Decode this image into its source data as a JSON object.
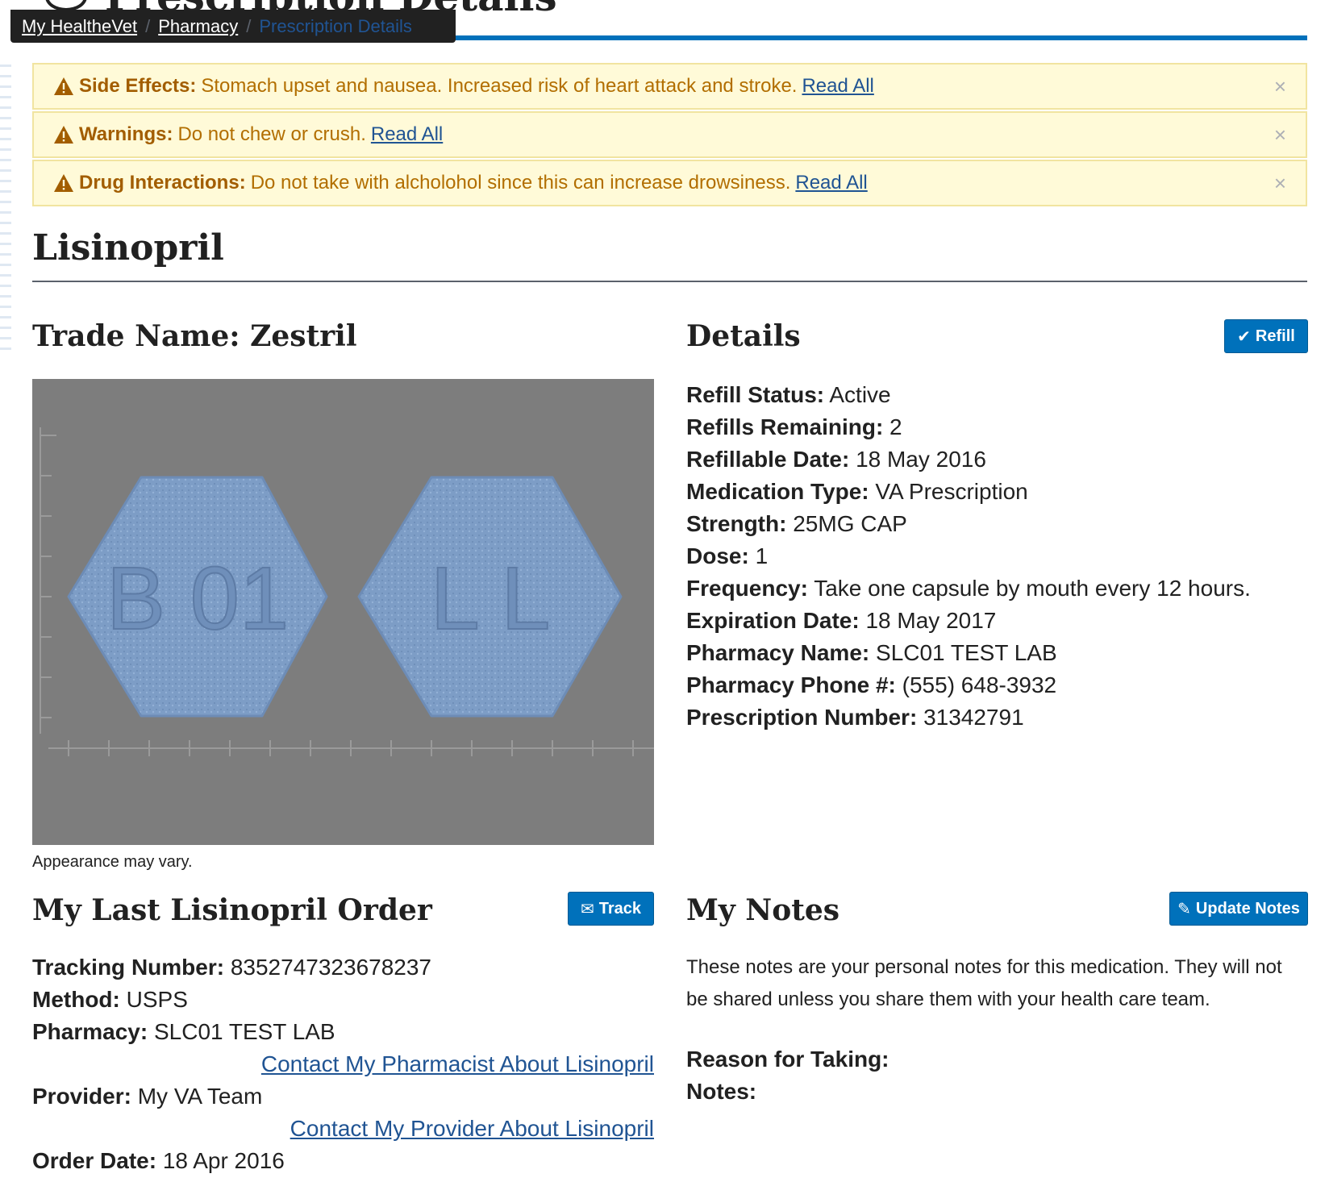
{
  "page": {
    "title": "Prescription Details"
  },
  "breadcrumb": [
    {
      "label": "My HealtheVet"
    },
    {
      "label": "Pharmacy"
    },
    {
      "label": "Prescription Details"
    }
  ],
  "alerts": [
    {
      "label": "Side Effects:",
      "message": "Stomach upset and nausea. Increased risk of heart attack and stroke.",
      "link": "Read All",
      "close": "×"
    },
    {
      "label": "Warnings:",
      "message": "Do not chew or crush.",
      "link": "Read All",
      "close": "×"
    },
    {
      "label": "Drug Interactions:",
      "message": "Do not take with alcholohol since this can increase drowsiness.",
      "link": "Read All",
      "close": "×"
    }
  ],
  "drug": {
    "name": "Lisinopril",
    "trade_name_heading": "Trade Name: Zestril",
    "image_caption": "Appearance may vary.",
    "pill_imprints": [
      "B 01",
      "L L"
    ]
  },
  "details": {
    "heading": "Details",
    "refill_button": "Refill",
    "rows": [
      {
        "label": "Refill Status:",
        "value": "Active"
      },
      {
        "label": "Refills Remaining:",
        "value": "2"
      },
      {
        "label": "Refillable Date:",
        "value": "18 May 2016"
      },
      {
        "label": "Medication Type:",
        "value": "VA Prescription"
      },
      {
        "label": "Strength:",
        "value": "25MG CAP"
      },
      {
        "label": "Dose:",
        "value": "1"
      },
      {
        "label": "Frequency:",
        "value": "Take one capsule by mouth every 12 hours."
      },
      {
        "label": "Expiration Date:",
        "value": "18 May 2017"
      },
      {
        "label": "Pharmacy Name:",
        "value": "SLC01 TEST LAB"
      },
      {
        "label": "Pharmacy Phone #:",
        "value": "(555) 648-3932"
      },
      {
        "label": "Prescription Number:",
        "value": "31342791"
      }
    ]
  },
  "order": {
    "heading": "My Last Lisinopril Order",
    "track_button": "Track",
    "tracking_label": "Tracking Number:",
    "tracking_value": "8352747323678237",
    "method_label": "Method:",
    "method_value": "USPS",
    "pharmacy_label": "Pharmacy:",
    "pharmacy_value": "SLC01 TEST LAB",
    "contact_pharmacist": "Contact My Pharmacist About Lisinopril",
    "provider_label": "Provider:",
    "provider_value": "My VA Team",
    "contact_provider": "Contact My Provider About Lisinopril",
    "order_date_label": "Order Date:",
    "order_date_value": "18 Apr 2016"
  },
  "notes": {
    "heading": "My Notes",
    "update_button": "Update Notes",
    "description": "These notes are your personal notes for this medication. They will not be shared unless you share them with your health care team.",
    "reason_label": "Reason for Taking:",
    "notes_label": "Notes:"
  },
  "colors": {
    "primary": "#0071bb",
    "link": "#205493",
    "alert_bg": "#fffad8",
    "alert_text": "#b26e00"
  }
}
